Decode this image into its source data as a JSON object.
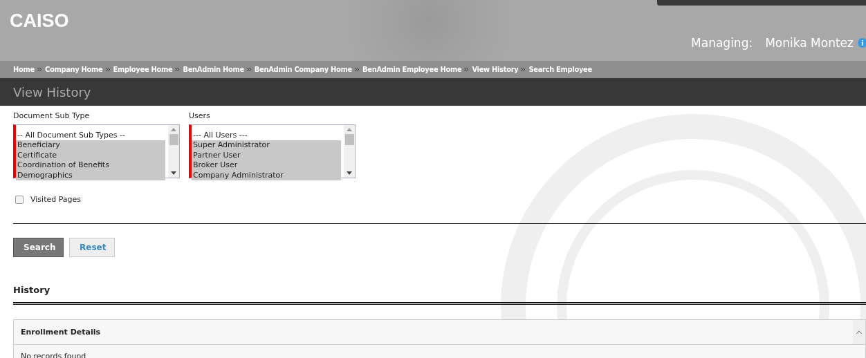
{
  "header": {
    "logo": "CAISO",
    "managing_label": "Managing:",
    "managing_name": "Monika Montez"
  },
  "breadcrumbs": [
    "Home",
    "Company Home",
    "Employee Home",
    "BenAdmin Home",
    "BenAdmin Company Home",
    "BenAdmin Employee Home",
    "View History",
    "Search Employee"
  ],
  "page_title": "View History",
  "filters": [
    {
      "label": "Document Sub Type",
      "options": [
        {
          "text": "-- All Document Sub Types --",
          "selected": false
        },
        {
          "text": "Beneficiary",
          "selected": true
        },
        {
          "text": "Certificate",
          "selected": true
        },
        {
          "text": "Coordination of Benefits",
          "selected": true
        },
        {
          "text": "Demographics",
          "selected": true
        }
      ]
    },
    {
      "label": "Users",
      "options": [
        {
          "text": "--- All Users ---",
          "selected": false
        },
        {
          "text": "Super Administrator",
          "selected": true
        },
        {
          "text": "Partner User",
          "selected": true
        },
        {
          "text": "Broker User",
          "selected": true
        },
        {
          "text": "Company Administrator",
          "selected": true
        }
      ]
    }
  ],
  "visited_pages": {
    "label": "Visited Pages",
    "checked": false
  },
  "buttons": [
    {
      "label": "Search",
      "kind": "primary"
    },
    {
      "label": "Reset",
      "kind": "secondary"
    }
  ],
  "history": {
    "title": "History",
    "panel_title": "Enrollment Details",
    "expanded": true,
    "empty_text": "No records found"
  }
}
